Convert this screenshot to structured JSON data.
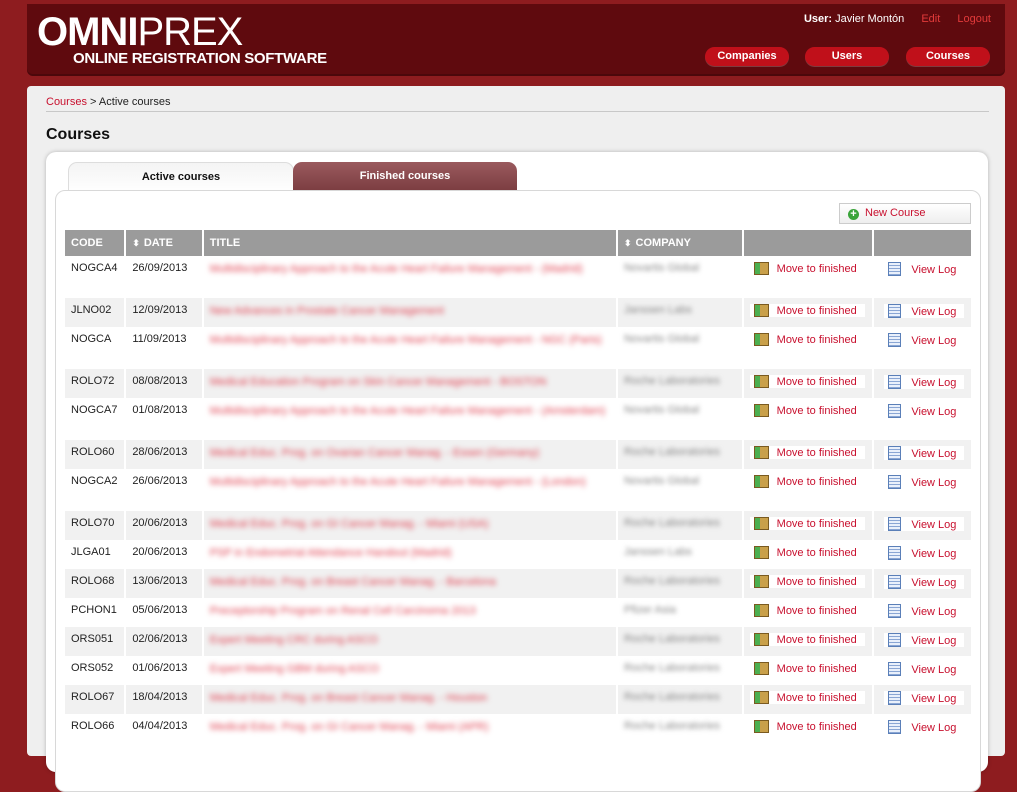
{
  "brand": {
    "logo_main_bold": "OMNI",
    "logo_main_light": "PREX",
    "logo_sub": "ONLINE REGISTRATION SOFTWARE"
  },
  "user": {
    "label": "User:",
    "name": "Javier Montón",
    "edit": "Edit",
    "logout": "Logout"
  },
  "nav": {
    "companies": "Companies",
    "users": "Users",
    "courses": "Courses"
  },
  "breadcrumb": {
    "root": "Courses",
    "sep": ">",
    "current": "Active courses"
  },
  "page_title": "Courses",
  "tabs": {
    "active": "Active courses",
    "finished": "Finished courses"
  },
  "new_course_label": "New Course",
  "table": {
    "headers": {
      "code": "CODE",
      "date": "DATE",
      "title": "TITLE",
      "company": "COMPANY"
    },
    "sort_icon": "⬍",
    "action_move": "Move to finished",
    "action_log": "View Log",
    "rows": [
      {
        "code": "NOGCA4",
        "date": "26/09/2013",
        "title": "Multidisciplinary Approach to the Acute Heart Failure Management - (Madrid)",
        "company": "Novartis Global"
      },
      {
        "code": "JLNO02",
        "date": "12/09/2013",
        "title": "New Advances in Prostate Cancer Management",
        "company": "Janssen Labs"
      },
      {
        "code": "NOGCA",
        "date": "11/09/2013",
        "title": "Multidisciplinary Approach to the Acute Heart Failure Management - NGC (Paris)",
        "company": "Novartis Global"
      },
      {
        "code": "ROLO72",
        "date": "08/08/2013",
        "title": "Medical Education Program on Skin Cancer Management - BOSTON",
        "company": "Roche Laboratories"
      },
      {
        "code": "NOGCA7",
        "date": "01/08/2013",
        "title": "Multidisciplinary Approach to the Acute Heart Failure Management - (Amsterdam)",
        "company": "Novartis Global"
      },
      {
        "code": "ROLO60",
        "date": "28/06/2013",
        "title": "Medical Educ. Prog. on Ovarian Cancer Manag. - Essen (Germany)",
        "company": "Roche Laboratories"
      },
      {
        "code": "NOGCA2",
        "date": "26/06/2013",
        "title": "Multidisciplinary Approach to the Acute Heart Failure Management - (London)",
        "company": "Novartis Global"
      },
      {
        "code": "ROLO70",
        "date": "20/06/2013",
        "title": "Medical Educ. Prog. on GI Cancer Manag. - Miami (USA)",
        "company": "Roche Laboratories"
      },
      {
        "code": "JLGA01",
        "date": "20/06/2013",
        "title": "PSP in Endometrial Attendance Handout (Madrid)",
        "company": "Janssen Labs"
      },
      {
        "code": "ROLO68",
        "date": "13/06/2013",
        "title": "Medical Educ. Prog. on Breast Cancer Manag. - Barcelona",
        "company": "Roche Laboratories"
      },
      {
        "code": "PCHON1",
        "date": "05/06/2013",
        "title": "Preceptorship Program on Renal Cell Carcinoma 2013",
        "company": "Pfizer Asia"
      },
      {
        "code": "ORS051",
        "date": "02/06/2013",
        "title": "Expert Meeting CRC during ASCO",
        "company": "Roche Laboratories"
      },
      {
        "code": "ORS052",
        "date": "01/06/2013",
        "title": "Expert Meeting GBM during ASCO",
        "company": "Roche Laboratories"
      },
      {
        "code": "ROLO67",
        "date": "18/04/2013",
        "title": "Medical Educ. Prog. on Breast Cancer Manag. - Houston",
        "company": "Roche Laboratories"
      },
      {
        "code": "ROLO66",
        "date": "04/04/2013",
        "title": "Medical Educ. Prog. on GI Cancer Manag. - Miami (APR)",
        "company": "Roche Laboratories"
      }
    ]
  }
}
